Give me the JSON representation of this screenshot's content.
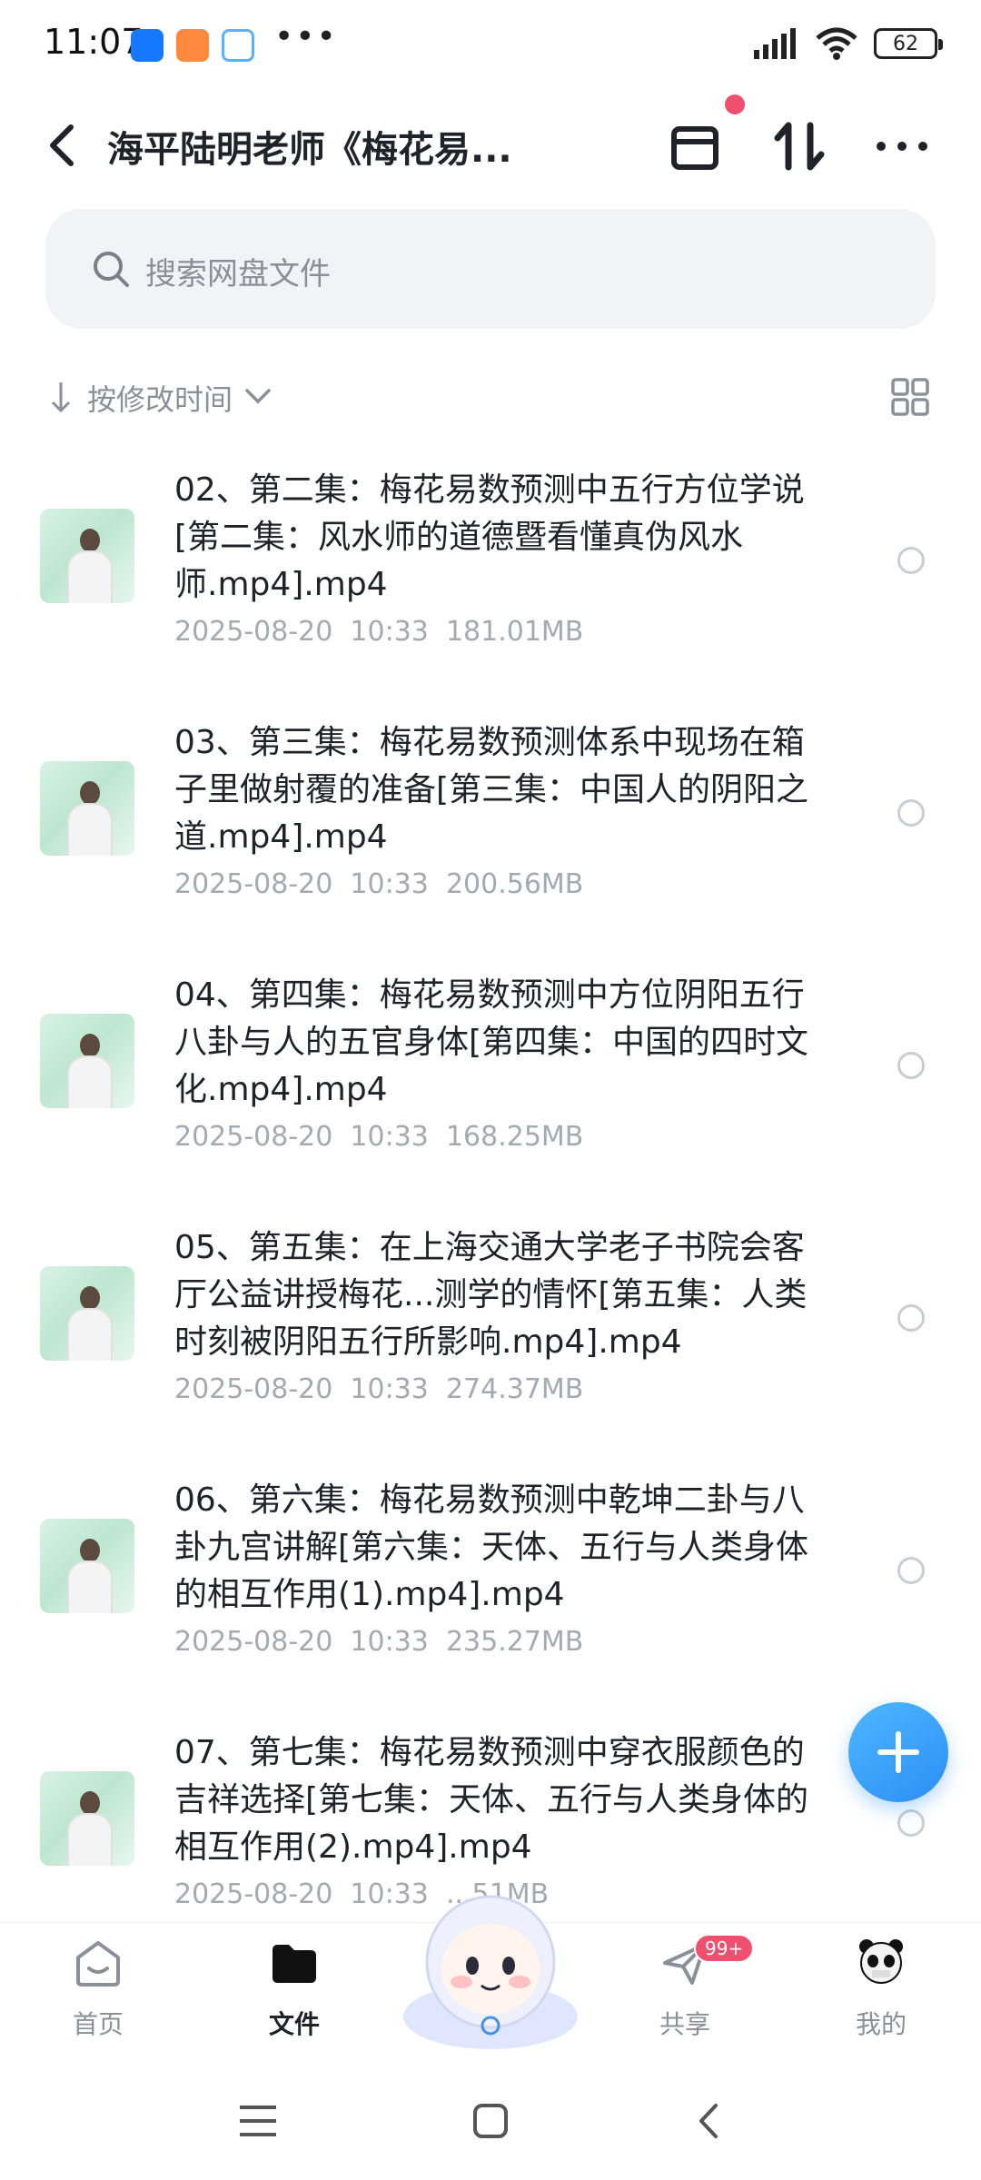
{
  "status_bar": {
    "time": "11:07",
    "dots": "•••",
    "battery": "62"
  },
  "header": {
    "title": "海平陆明老师《梅花易...",
    "icons": [
      "back-icon",
      "archive-box-icon",
      "sort-updown-icon",
      "more-icon"
    ]
  },
  "search": {
    "placeholder": "搜索网盘文件"
  },
  "sort": {
    "label": "按修改时间"
  },
  "files": [
    {
      "name": "02、第二集：梅花易数预测中五行方位学说[第二集：风水师的道德暨看懂真伪风水师.mp4].mp4",
      "meta": "2025-08-20  10:33  181.01MB"
    },
    {
      "name": "03、第三集：梅花易数预测体系中现场在箱子里做射覆的准备[第三集：中国人的阴阳之道.mp4].mp4",
      "meta": "2025-08-20  10:33  200.56MB"
    },
    {
      "name": "04、第四集：梅花易数预测中方位阴阳五行八卦与人的五官身体[第四集：中国的四时文化.mp4].mp4",
      "meta": "2025-08-20  10:33  168.25MB"
    },
    {
      "name": "05、第五集：在上海交通大学老子书院会客厅公益讲授梅花...测学的情怀[第五集：人类时刻被阴阳五行所影响.mp4].mp4",
      "meta": "2025-08-20  10:33  274.37MB"
    },
    {
      "name": "06、第六集：梅花易数预测中乾坤二卦与八卦九宫讲解[第六集：天体、五行与人类身体的相互作用(1).mp4].mp4",
      "meta": "2025-08-20  10:33  235.27MB"
    },
    {
      "name": "07、第七集：梅花易数预测中穿衣服颜色的吉祥选择[第七集：天体、五行与人类身体的相互作用(2).mp4].mp4",
      "meta": "2025-08-20  10:33  ...51MB"
    }
  ],
  "bottom_nav": {
    "home": "首页",
    "files": "文件",
    "share": "共享",
    "share_badge": "99+",
    "mine": "我的"
  },
  "colors": {
    "accent": "#2b8ef5",
    "badge": "#f0506e",
    "meta_text": "#a4a9b2"
  }
}
